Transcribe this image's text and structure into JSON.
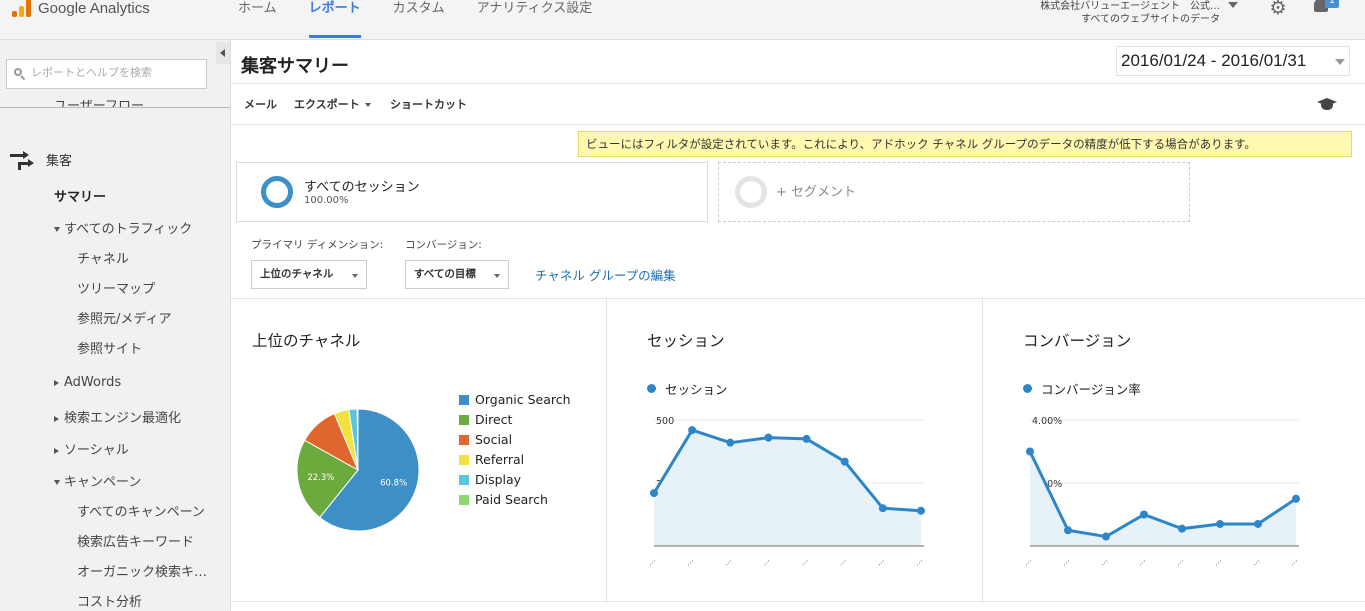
{
  "header": {
    "logo_text": "Google Analytics",
    "nav": [
      "ホーム",
      "レポート",
      "カスタム",
      "アナリティクス設定"
    ],
    "active_nav": 1,
    "account_name": "株式会社バリューエージェント　公式…",
    "account_view": "すべてのウェブサイトのデータ",
    "notification_count": "1"
  },
  "sidebar": {
    "search_placeholder": "レポートとヘルプを検索",
    "cut_item": "ユーザーフロー",
    "section": "集客",
    "items": [
      {
        "label": "サマリー",
        "level": 1,
        "bold": true
      },
      {
        "label": "すべてのトラフィック",
        "level": 1,
        "toggle": "open"
      },
      {
        "label": "チャネル",
        "level": 2
      },
      {
        "label": "ツリーマップ",
        "level": 2
      },
      {
        "label": "参照元/メディア",
        "level": 2
      },
      {
        "label": "参照サイト",
        "level": 2
      },
      {
        "label": "AdWords",
        "level": 1,
        "toggle": "closed"
      },
      {
        "label": "検索エンジン最適化",
        "level": 1,
        "toggle": "closed"
      },
      {
        "label": "ソーシャル",
        "level": 1,
        "toggle": "closed"
      },
      {
        "label": "キャンペーン",
        "level": 1,
        "toggle": "open"
      },
      {
        "label": "すべてのキャンペーン",
        "level": 2
      },
      {
        "label": "検索広告キーワード",
        "level": 2
      },
      {
        "label": "オーガニック検索キ…",
        "level": 2
      },
      {
        "label": "コスト分析",
        "level": 2
      }
    ]
  },
  "main": {
    "title": "集客サマリー",
    "date_range": "2016/01/24 - 2016/01/31",
    "toolbar": {
      "email": "メール",
      "export": "エクスポート",
      "shortcut": "ショートカット"
    },
    "notice": "ビューにはフィルタが設定されています。これにより、アドホック チャネル グループのデータの精度が低下する場合があります。",
    "segment": {
      "name": "すべてのセッション",
      "pct": "100.00%",
      "add_label": "+ セグメント"
    },
    "primary_dimension_label": "プライマリ ディメンション:",
    "conversion_label": "コンバージョン:",
    "dimension_value": "上位のチャネル",
    "conversion_value": "すべての目標",
    "edit_link": "チャネル グループの編集"
  },
  "chart_data": [
    {
      "type": "pie",
      "title": "上位のチャネル",
      "categories": [
        "Organic Search",
        "Direct",
        "Social",
        "Referral",
        "Display",
        "Paid Search"
      ],
      "values": [
        60.8,
        22.3,
        10.6,
        3.9,
        2.2,
        0.2
      ],
      "labels": [
        "60.8%",
        "22.3%",
        "",
        "",
        "",
        ""
      ],
      "colors": [
        "#3d8fc6",
        "#6bab3d",
        "#e1662e",
        "#f3e23e",
        "#5bc3de",
        "#8ed86f"
      ],
      "legend": "right"
    },
    {
      "type": "area",
      "title": "セッション",
      "series": [
        {
          "name": "セッション",
          "values": [
            210,
            460,
            410,
            430,
            425,
            335,
            150,
            140
          ]
        }
      ],
      "ylim": [
        0,
        500
      ],
      "yticks": [
        "500",
        "250"
      ],
      "xtick": "…",
      "color": "#2e86c8"
    },
    {
      "type": "area",
      "title": "コンバージョン",
      "series": [
        {
          "name": "コンバージョン率",
          "values": [
            3.0,
            0.5,
            0.3,
            1.0,
            0.55,
            0.7,
            0.7,
            1.5
          ]
        }
      ],
      "ylim": [
        0,
        4
      ],
      "yticks": [
        "4.00%",
        "2.00%"
      ],
      "xtick": "…",
      "color": "#2e86c8"
    }
  ]
}
